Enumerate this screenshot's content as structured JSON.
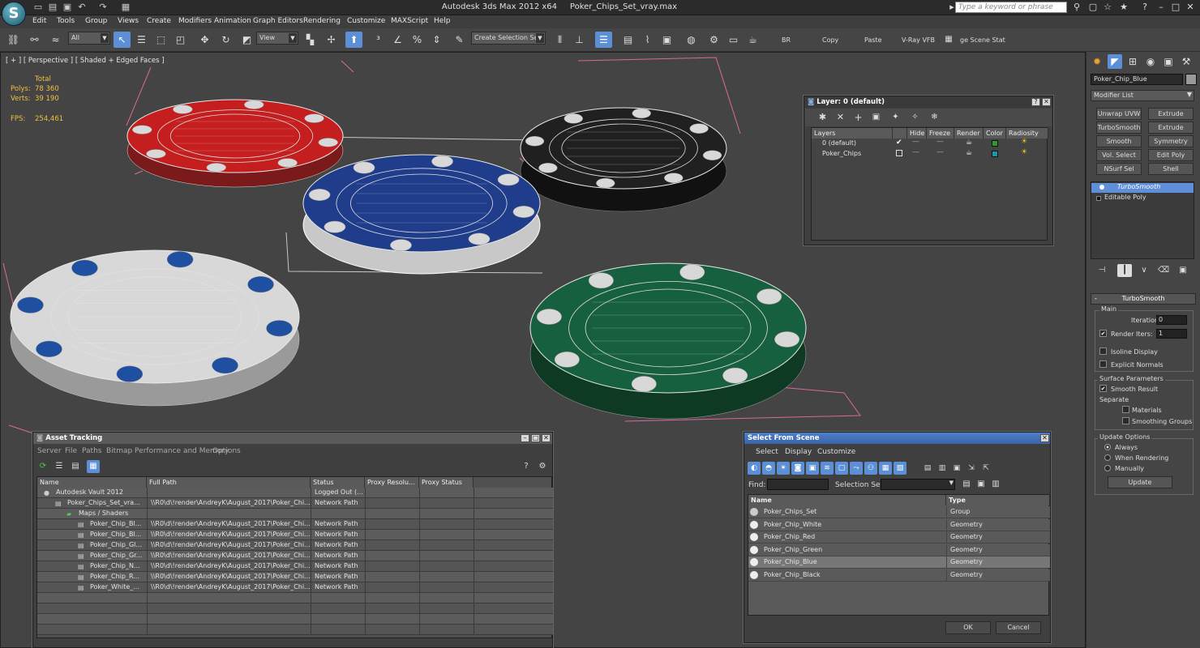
{
  "app": {
    "title": "Autodesk 3ds Max  2012 x64",
    "file": "Poker_Chips_Set_vray.max",
    "search_placeholder": "Type a keyword or phrase",
    "logo": "3ds-max-logo"
  },
  "menu": [
    "Edit",
    "Tools",
    "Group",
    "Views",
    "Create",
    "Modifiers",
    "Animation",
    "Graph Editors",
    "Rendering",
    "Customize",
    "MAXScript",
    "Help"
  ],
  "toolbar": {
    "filter": "All",
    "coord": "View",
    "sel_set": "Create Selection Se",
    "br": "BR",
    "copy": "Copy",
    "paste": "Paste",
    "vfb": "V-Ray VFB",
    "scene": "ge Scene Stat"
  },
  "viewport": {
    "label": "[ + ] [ Perspective ] [ Shaded + Edged Faces ]",
    "stats": {
      "total": "Total",
      "polys_label": "Polys:",
      "polys": "78 360",
      "verts_label": "Verts:",
      "verts": "39 190",
      "fps_label": "FPS:",
      "fps": "254,461"
    },
    "chips": [
      {
        "color": "#c41e1e"
      },
      {
        "color": "#202020"
      },
      {
        "color": "#1f3d8a"
      },
      {
        "color": "#17603f"
      },
      {
        "color": "#d8d8d8"
      }
    ]
  },
  "layer_dialog": {
    "title": "Layer: 0 (default)",
    "headers": [
      "Layers",
      "Hide",
      "Freeze",
      "Render",
      "Color",
      "Radiosity"
    ],
    "rows": [
      {
        "name": "0 (default)",
        "color": "#2e9a2e"
      },
      {
        "name": "Poker_Chips",
        "color": "#1a9aa8"
      }
    ]
  },
  "command_panel": {
    "object_name": "Poker_Chip_Blue",
    "modifier_list": "Modifier List",
    "buttons": [
      "Unwrap UVW",
      "Extrude",
      "TurboSmooth",
      "Extrude",
      "Smooth",
      "Symmetry",
      "Vol. Select",
      "Edit Poly",
      "NSurf Sel",
      "Shell"
    ],
    "stack": [
      "TurboSmooth",
      "Editable Poly"
    ],
    "rollout": {
      "title": "TurboSmooth",
      "main": "Main",
      "iterations_label": "Iterations:",
      "iterations": "0",
      "render_iters_label": "Render Iters:",
      "render_iters": "1",
      "isoline": "Isoline Display",
      "explicit": "Explicit Normals",
      "surface": "Surface Parameters",
      "smooth_result": "Smooth Result",
      "separate": "Separate",
      "materials": "Materials",
      "smoothing_groups": "Smoothing Groups",
      "update_options": "Update Options",
      "always": "Always",
      "when_rendering": "When Rendering",
      "manually": "Manually",
      "update": "Update"
    }
  },
  "asset_tracking": {
    "title": "Asset Tracking",
    "menu": [
      "Server",
      "File",
      "Paths",
      "Bitmap Performance and Memory",
      "Options"
    ],
    "headers": [
      "Name",
      "Full Path",
      "Status",
      "Proxy Resolu...",
      "Proxy Status"
    ],
    "rows": [
      {
        "name": "Autodesk Vault 2012",
        "path": "",
        "status": "Logged Out (..."
      },
      {
        "name": "Poker_Chips_Set_vra...",
        "path": "\\\\R0\\d\\!render\\AndreyK\\August_2017\\Poker_Chi...",
        "status": "Network Path"
      },
      {
        "name": "Maps / Shaders",
        "path": "",
        "status": ""
      },
      {
        "name": "Poker_Chip_Bl...",
        "path": "\\\\R0\\d\\!render\\AndreyK\\August_2017\\Poker_Chi...",
        "status": "Network Path"
      },
      {
        "name": "Poker_Chip_Bl...",
        "path": "\\\\R0\\d\\!render\\AndreyK\\August_2017\\Poker_Chi...",
        "status": "Network Path"
      },
      {
        "name": "Poker_Chip_Gl...",
        "path": "\\\\R0\\d\\!render\\AndreyK\\August_2017\\Poker_Chi...",
        "status": "Network Path"
      },
      {
        "name": "Poker_Chip_Gr...",
        "path": "\\\\R0\\d\\!render\\AndreyK\\August_2017\\Poker_Chi...",
        "status": "Network Path"
      },
      {
        "name": "Poker_Chip_N...",
        "path": "\\\\R0\\d\\!render\\AndreyK\\August_2017\\Poker_Chi...",
        "status": "Network Path"
      },
      {
        "name": "Poker_Chip_R...",
        "path": "\\\\R0\\d\\!render\\AndreyK\\August_2017\\Poker_Chi...",
        "status": "Network Path"
      },
      {
        "name": "Poker_White_...",
        "path": "\\\\R0\\d\\!render\\AndreyK\\August_2017\\Poker_Chi...",
        "status": "Network Path"
      }
    ]
  },
  "select_scene": {
    "title": "Select From Scene",
    "menu": [
      "Select",
      "Display",
      "Customize"
    ],
    "find_label": "Find:",
    "selset_label": "Selection Set:",
    "headers": [
      "Name",
      "Type"
    ],
    "rows": [
      {
        "name": "Poker_Chips_Set",
        "type": "Group"
      },
      {
        "name": "Poker_Chip_White",
        "type": "Geometry"
      },
      {
        "name": "Poker_Chip_Red",
        "type": "Geometry"
      },
      {
        "name": "Poker_Chip_Green",
        "type": "Geometry"
      },
      {
        "name": "Poker_Chip_Blue",
        "type": "Geometry"
      },
      {
        "name": "Poker_Chip_Black",
        "type": "Geometry"
      }
    ],
    "ok": "OK",
    "cancel": "Cancel"
  }
}
